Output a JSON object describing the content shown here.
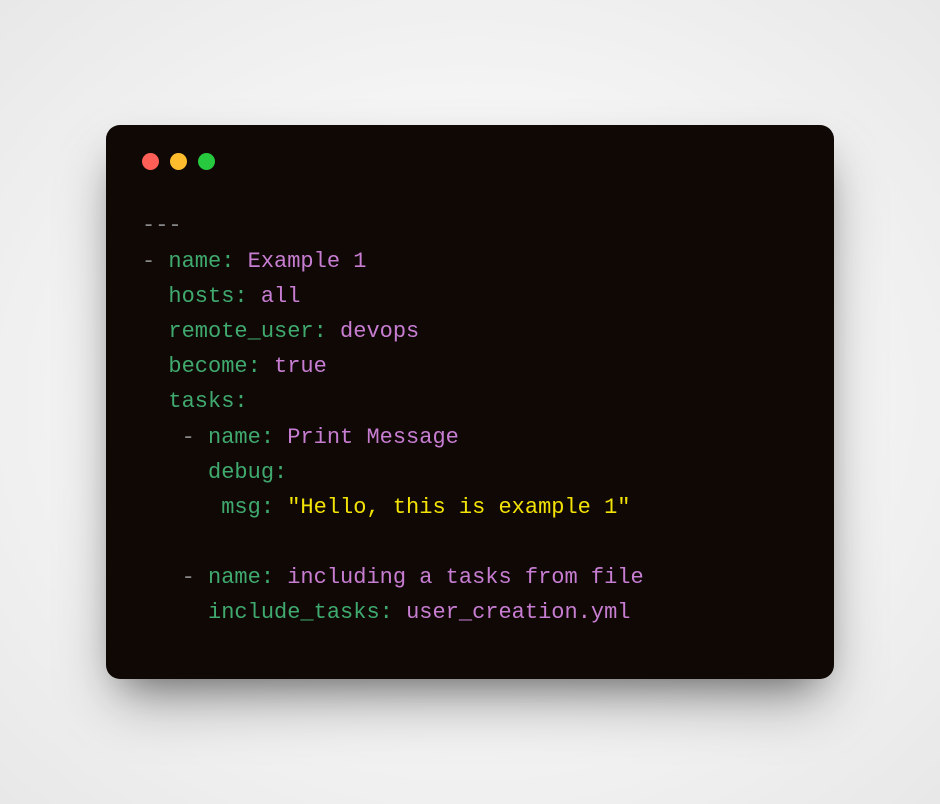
{
  "colors": {
    "red": "#ff5f56",
    "yellow": "#ffbd2e",
    "green": "#27c93f",
    "key": "#3fa96e",
    "string": "#c77dd1",
    "quoted": "#f2e205"
  },
  "yaml": {
    "doc_start": "---",
    "play": {
      "name_key": "name:",
      "name_val": "Example ",
      "name_num": "1",
      "hosts_key": "hosts:",
      "hosts_val": "all",
      "remote_user_key": "remote_user:",
      "remote_user_val": "devops",
      "become_key": "become:",
      "become_val": "true",
      "tasks_key": "tasks:"
    },
    "task1": {
      "name_key": "name:",
      "name_val": "Print Message",
      "module_key": "debug:",
      "msg_key": "msg:",
      "msg_val": "\"Hello, this is example 1\""
    },
    "task2": {
      "name_key": "name:",
      "name_val": "including a tasks from file",
      "include_key": "include_tasks:",
      "include_val": "user_creation.yml"
    }
  }
}
